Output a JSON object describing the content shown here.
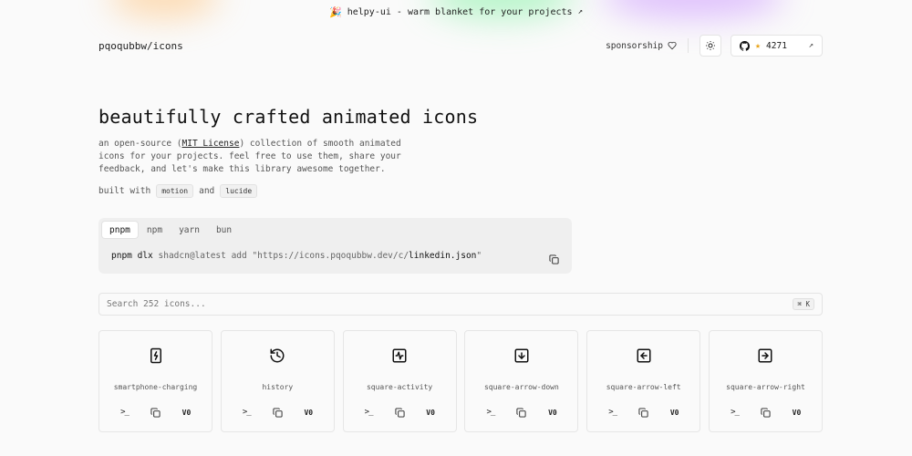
{
  "banner": {
    "emoji": "🎉",
    "text": "helpy-ui - warm blanket for your projects",
    "arrow": "↗"
  },
  "nav": {
    "brand": "pqoqubbw/icons",
    "sponsor_label": "sponsorship",
    "github_stars": "4271",
    "star_glyph": "★",
    "ext_glyph": "↗"
  },
  "hero": {
    "title": "beautifully crafted animated icons",
    "desc_before": "an open-source (",
    "license": "MIT License",
    "desc_after": ") collection of smooth animated icons for your projects. feel free to use them, share your feedback, and let's make this library awesome together.",
    "built_with": "built with",
    "and": "and",
    "tag1": "motion",
    "tag2": "lucide"
  },
  "install": {
    "tabs": [
      "pnpm",
      "npm",
      "yarn",
      "bun"
    ],
    "active_tab": "pnpm",
    "cmd_bin": "pnpm dlx",
    "cmd_mid": "shadcn@latest add \"https://icons.pqoqubbw.dev/c/",
    "cmd_file": "linkedin.json",
    "cmd_end": "\""
  },
  "search": {
    "placeholder": "Search 252 icons...",
    "shortcut": "⌘ K"
  },
  "icons": [
    {
      "name": "smartphone-charging",
      "icon": "smartphone-charging-icon"
    },
    {
      "name": "history",
      "icon": "history-icon"
    },
    {
      "name": "square-activity",
      "icon": "square-activity-icon"
    },
    {
      "name": "square-arrow-down",
      "icon": "square-arrow-down-icon"
    },
    {
      "name": "square-arrow-left",
      "icon": "square-arrow-left-icon"
    },
    {
      "name": "square-arrow-right",
      "icon": "square-arrow-right-icon"
    }
  ],
  "card_actions": {
    "terminal": ">_",
    "v0": "V0"
  },
  "colors": {
    "background": "#fafafa",
    "accent_star": "#e8a41a",
    "glow_orange": "#ffb36b",
    "glow_green": "#8ff0a4",
    "glow_purple": "#c58cff"
  }
}
